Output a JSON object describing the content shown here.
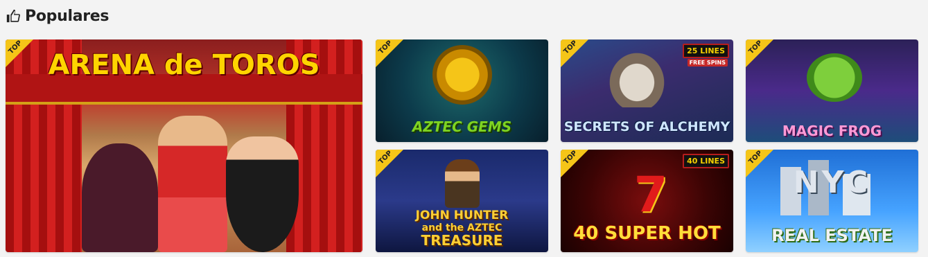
{
  "section": {
    "title": "Populares",
    "icon": "thumbs-up-icon"
  },
  "badge_label": "TOP",
  "games": {
    "arena": {
      "title": "ARENA de TOROS"
    },
    "aztec": {
      "title": "AZTEC GEMS"
    },
    "alchemy": {
      "title": "SECRETS OF ALCHEMY",
      "lines": "25 LINES",
      "extra": "FREE SPINS"
    },
    "frog": {
      "title": "MAGIC FROG"
    },
    "john": {
      "title_line1": "JOHN HUNTER",
      "title_line2": "and the AZTEC",
      "title_line3": "TREASURE"
    },
    "hot": {
      "title": "40 SUPER HOT",
      "lines": "40 LINES",
      "symbol": "7"
    },
    "nyc": {
      "logo": "NYC",
      "title": "REAL ESTATE"
    }
  },
  "colors": {
    "badge": "#f5c518",
    "background": "#f3f3f3"
  }
}
